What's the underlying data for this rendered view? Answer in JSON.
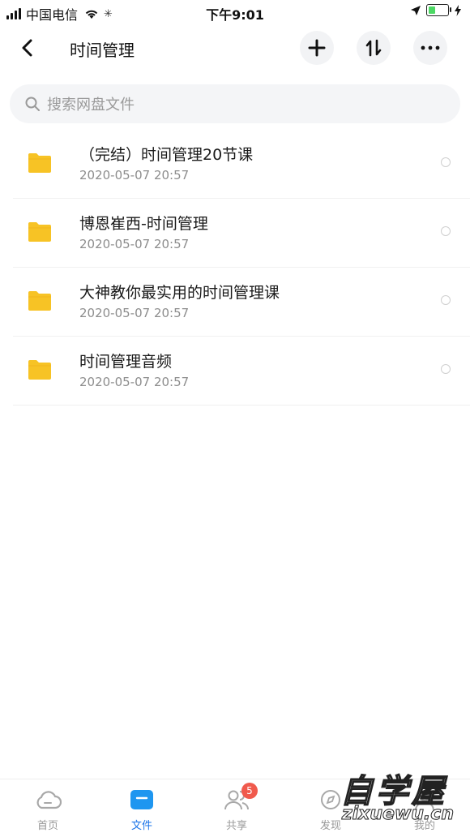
{
  "status_bar": {
    "carrier": "中国电信",
    "time": "下午9:01"
  },
  "navbar": {
    "title": "时间管理",
    "icons": [
      "back-arrow-icon",
      "plus-icon",
      "sort-icon",
      "more-icon"
    ]
  },
  "search": {
    "placeholder": "搜索网盘文件"
  },
  "files": [
    {
      "name": "（完结）时间管理20节课",
      "date": "2020-05-07 20:57"
    },
    {
      "name": "博恩崔西-时间管理",
      "date": "2020-05-07 20:57"
    },
    {
      "name": "大神教你最实用的时间管理课",
      "date": "2020-05-07 20:57"
    },
    {
      "name": "时间管理音频",
      "date": "2020-05-07 20:57"
    }
  ],
  "tabbar": {
    "tabs": [
      {
        "label": "首页",
        "icon": "cloud-icon"
      },
      {
        "label": "文件",
        "icon": "folder-icon",
        "active": true
      },
      {
        "label": "共享",
        "icon": "people-icon",
        "badge": "5"
      },
      {
        "label": "发现",
        "icon": "discover-icon"
      },
      {
        "label": "我的",
        "icon": "user-icon"
      }
    ]
  },
  "colors": {
    "accent": "#1a73e8",
    "folder": "#f7c325",
    "badge": "#f05a4d"
  },
  "watermark": {
    "chinese": "自学屋",
    "url": "zixuewu.cn"
  }
}
